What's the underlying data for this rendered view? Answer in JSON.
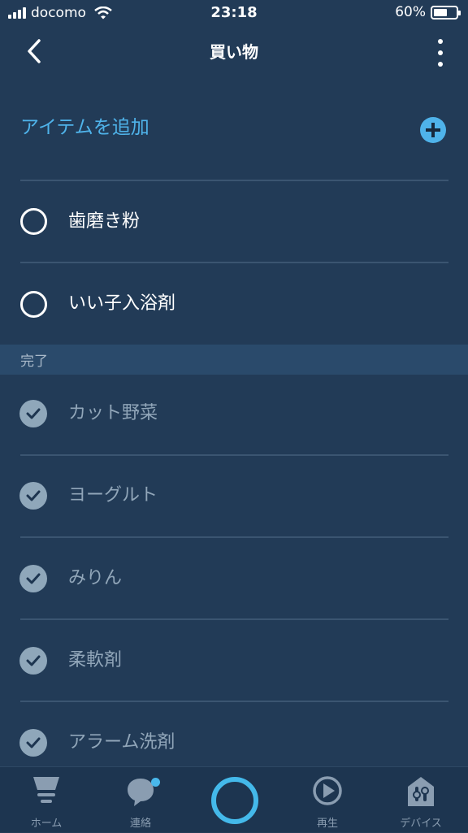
{
  "status_bar": {
    "carrier": "docomo",
    "time": "23:18",
    "battery": "60%",
    "battery_level": 0.6
  },
  "header": {
    "title": "買い物",
    "back_icon": "chevron-left-icon",
    "more_icon": "more-vertical-icon"
  },
  "add_item": {
    "label": "アイテムを追加",
    "icon": "plus-circle-icon",
    "accent_color": "#4fb3ea"
  },
  "active_items": [
    {
      "label": "歯磨き粉"
    },
    {
      "label": "いい子入浴剤"
    }
  ],
  "completed_section": {
    "title": "完了",
    "items": [
      {
        "label": "カット野菜"
      },
      {
        "label": "ヨーグルト"
      },
      {
        "label": "みりん"
      },
      {
        "label": "柔軟剤"
      },
      {
        "label": "アラーム洗剤"
      }
    ]
  },
  "tabbar": {
    "tabs": [
      {
        "label": "ホーム",
        "icon": "home-icon"
      },
      {
        "label": "連絡",
        "icon": "chat-icon"
      },
      {
        "label": "",
        "icon": "alexa-icon"
      },
      {
        "label": "再生",
        "icon": "play-icon"
      },
      {
        "label": "デバイス",
        "icon": "devices-icon"
      }
    ]
  }
}
